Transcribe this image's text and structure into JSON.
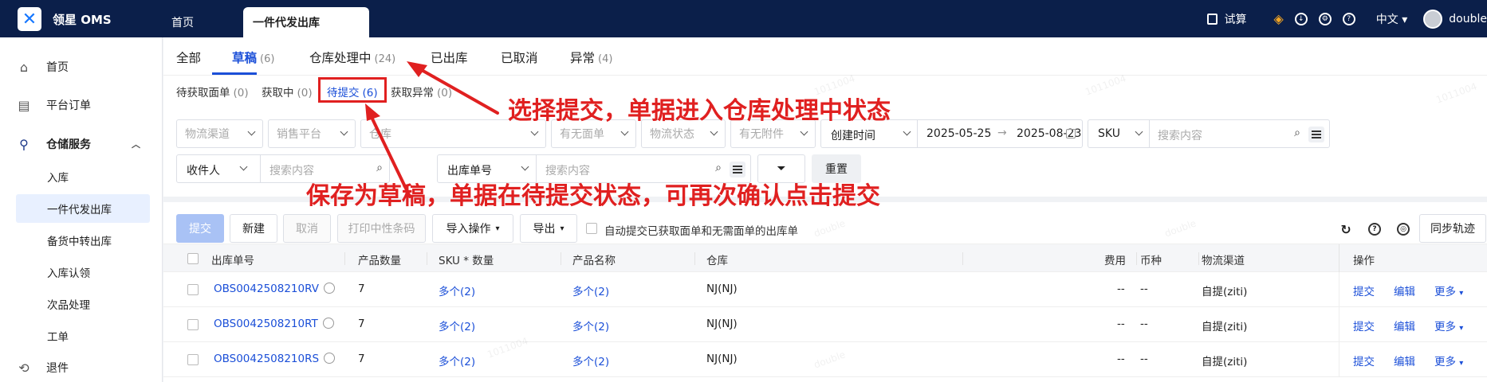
{
  "topbar": {
    "brand_name": "领星 OMS",
    "tabs": [
      "首页",
      "一件代发出库"
    ],
    "trial_label": "试算",
    "lang": "中文",
    "username": "double"
  },
  "sidebar": {
    "items": [
      {
        "label": "首页",
        "icon": "home-icon"
      },
      {
        "label": "平台订单",
        "icon": "clipboard-icon"
      },
      {
        "label": "仓储服务",
        "icon": "warehouse-icon"
      },
      {
        "label": "入库"
      },
      {
        "label": "一件代发出库"
      },
      {
        "label": "备货中转出库"
      },
      {
        "label": "入库认领"
      },
      {
        "label": "次品处理"
      },
      {
        "label": "工单"
      },
      {
        "label": "退件",
        "icon": "return-icon"
      }
    ]
  },
  "status_tabs": [
    {
      "label": "全部",
      "count": ""
    },
    {
      "label": "草稿",
      "count": "(6)"
    },
    {
      "label": "仓库处理中",
      "count": "(24)"
    },
    {
      "label": "已出库",
      "count": ""
    },
    {
      "label": "已取消",
      "count": ""
    },
    {
      "label": "异常",
      "count": "(4)"
    }
  ],
  "sub_tabs": [
    {
      "label": "待获取面单",
      "count": "(0)"
    },
    {
      "label": "获取中",
      "count": "(0)"
    },
    {
      "label": "待提交",
      "count": "(6)"
    },
    {
      "label": "获取异常",
      "count": "(0)"
    }
  ],
  "filters": {
    "logistics_channel": "物流渠道",
    "sales_platform": "销售平台",
    "warehouse": "仓库",
    "has_label": "有无面单",
    "logistics_status": "物流状态",
    "has_attachment": "有无附件",
    "time_type": "创建时间",
    "date_start": "2025-05-25",
    "date_end": "2025-08-23",
    "sku_select": "SKU",
    "search_placeholder": "搜索内容",
    "recipient_select": "收件人",
    "order_no_select": "出库单号",
    "reset": "重置"
  },
  "toolbar": {
    "submit": "提交",
    "new": "新建",
    "cancel": "取消",
    "print_barcode": "打印中性条码",
    "import": "导入操作",
    "export": "导出",
    "auto_submit": "自动提交已获取面单和无需面单的出库单",
    "sync_track": "同步轨迹"
  },
  "table": {
    "headers": [
      "出库单号",
      "产品数量",
      "SKU * 数量",
      "产品名称",
      "仓库",
      "费用",
      "币种",
      "物流渠道",
      "操作"
    ],
    "rows": [
      {
        "order_no": "OBS0042508210RV",
        "qty": "7",
        "sku": "多个(2)",
        "product": "多个(2)",
        "warehouse": "NJ(NJ)",
        "fee": "--",
        "currency": "--",
        "channel": "自提(ziti)"
      },
      {
        "order_no": "OBS0042508210RT",
        "qty": "7",
        "sku": "多个(2)",
        "product": "多个(2)",
        "warehouse": "NJ(NJ)",
        "fee": "--",
        "currency": "--",
        "channel": "自提(ziti)"
      },
      {
        "order_no": "OBS0042508210RS",
        "qty": "7",
        "sku": "多个(2)",
        "product": "多个(2)",
        "warehouse": "NJ(NJ)",
        "fee": "--",
        "currency": "--",
        "channel": "自提(ziti)"
      }
    ],
    "actions": {
      "submit": "提交",
      "edit": "编辑",
      "more": "更多"
    }
  },
  "annotations": {
    "top": "选择提交，单据进入仓库处理中状态",
    "bottom": "保存为草稿，单据在待提交状态，可再次确认点击提交"
  },
  "watermark": [
    "1011004",
    "double"
  ],
  "colors": {
    "nav_bg": "#0b1f4a",
    "accent": "#1b4fd8",
    "annotation": "#e02020"
  }
}
